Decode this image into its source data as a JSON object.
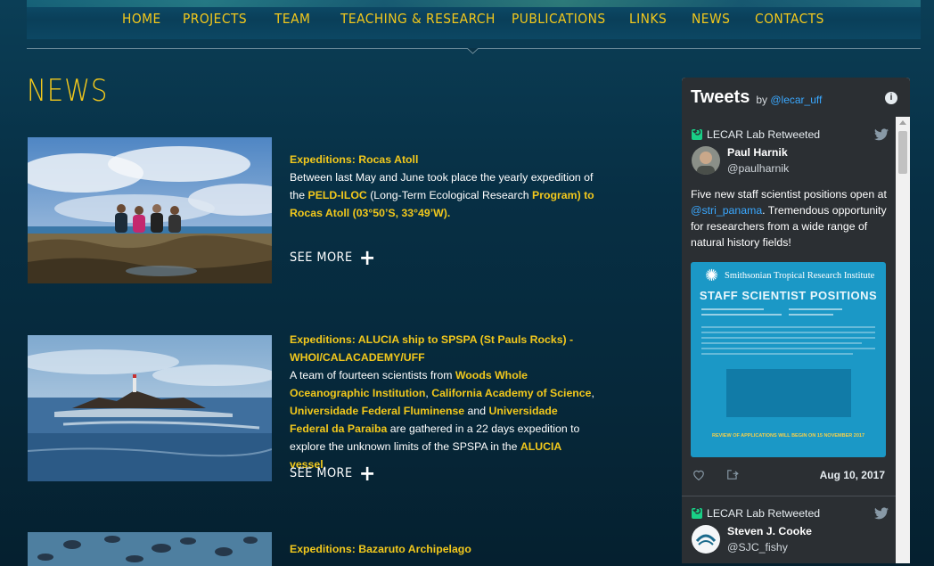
{
  "nav": {
    "items": [
      "HOME",
      "PROJECTS",
      "TEAM",
      "TEACHING & RESEARCH",
      "PUBLICATIONS",
      "LINKS",
      "NEWS",
      "CONTACTS"
    ]
  },
  "page": {
    "title": "NEWS"
  },
  "news": [
    {
      "title": "Expeditions: Rocas Atoll",
      "body_1": "Between last May and June took place the yearly expedition of the ",
      "hl_1": "PELD-ILOC",
      "body_2": " (Long-Term Ecological Research ",
      "hl_2": "Program) to Rocas Atoll (03°50’S, 33°49’W).",
      "see_more": "SEE MORE"
    },
    {
      "title": "Expeditions: ALUCIA ship to SPSPA (St Pauls Rocks) - WHOI/CALACADEMY/UFF",
      "body_1": "A team of fourteen scientists from ",
      "hl_1": "Woods Whole Oceanographic Institution",
      "sep_1": ", ",
      "hl_2": "California Academy of Science",
      "sep_2": ", ",
      "hl_3": "Universidade Federal Fluminense",
      "sep_3": " and ",
      "hl_4": "Universidade Federal da Paraiba",
      "body_2": " are gathered in a 22 days expedition to explore the unknown limits of the SPSPA in the ",
      "hl_5": "ALUCIA vessel",
      "body_3": ".",
      "see_more": "SEE MORE"
    },
    {
      "title": "Expeditions: Bazaruto Archipelago"
    }
  ],
  "tweets_widget": {
    "title": "Tweets",
    "by": "by",
    "account": "@lecar_uff",
    "info": "i",
    "tweets": [
      {
        "retweet_label": "LECAR Lab Retweeted",
        "name": "Paul Harnik",
        "handle": "@paulharnik",
        "text_1": "Five new staff scientist positions open at ",
        "mention": "@stri_panama",
        "text_2": ". Tremendous opportunity for researchers from a wide range of natural history fields!",
        "media": {
          "org": "Smithsonian Tropical Research Institute",
          "heading": "STAFF SCIENTIST POSITIONS",
          "deadline": "REVIEW OF APPLICATIONS WILL BEGIN ON 15 NOVEMBER 2017"
        },
        "date": "Aug 10, 2017"
      },
      {
        "retweet_label": "LECAR Lab Retweeted",
        "name": "Steven J. Cooke",
        "handle": "@SJC_fishy"
      }
    ]
  }
}
